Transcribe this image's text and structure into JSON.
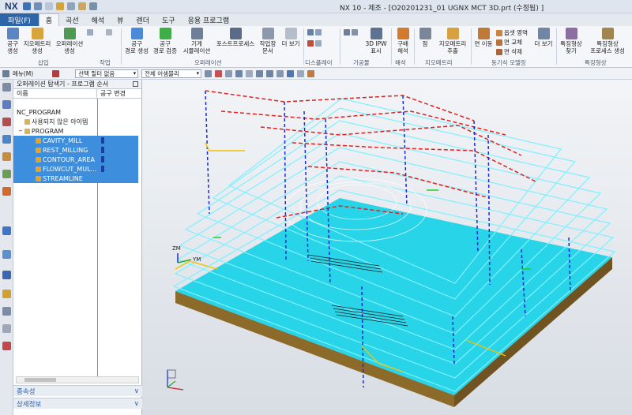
{
  "app": {
    "logo": "NX",
    "window_title": "NX 10 - 제조 - [O20201231_01 UGNX MCT 3D.prt (수정됨) ]"
  },
  "menu_tabs": {
    "file": "파일(F)",
    "tabs": [
      "홈",
      "곡선",
      "해석",
      "뷰",
      "렌더",
      "도구",
      "응용 프로그램"
    ]
  },
  "ribbon": {
    "buttons": [
      {
        "label": "공구\n생성",
        "icon": "create-tool-icon"
      },
      {
        "label": "지오메트리\n생성",
        "icon": "create-geometry-icon"
      },
      {
        "label": "오퍼레이션\n생성",
        "icon": "create-operation-icon"
      },
      {
        "label": "공구\n경로 생성",
        "icon": "generate-toolpath-icon"
      },
      {
        "label": "공구\n경로 검증",
        "icon": "verify-toolpath-icon"
      },
      {
        "label": "기계\n시뮬레이션",
        "icon": "machine-simulation-icon"
      },
      {
        "label": "포스트프로세스",
        "icon": "postprocess-icon"
      },
      {
        "label": "작업장\n문서",
        "icon": "shop-docs-icon"
      },
      {
        "label": "더 보기",
        "icon": "more-icon"
      },
      {
        "label": "3D IPW\n표시",
        "icon": "ipw-icon"
      },
      {
        "label": "구배\n해석",
        "icon": "draft-analysis-icon"
      },
      {
        "label": "점",
        "icon": "point-icon"
      },
      {
        "label": "지오메트리\n추출",
        "icon": "extract-geometry-icon"
      },
      {
        "label": "면 이동",
        "icon": "move-face-icon"
      },
      {
        "label": "더 보기",
        "icon": "more-icon-2"
      },
      {
        "label": "특징형상\n찾기",
        "icon": "find-feature-icon"
      },
      {
        "label": "특징형상\n프로세스 생성",
        "icon": "feature-process-icon"
      }
    ],
    "small_items": [
      "옵셋 영역",
      "면 교체",
      "면 삭제"
    ],
    "groups": [
      "삽입",
      "작업",
      "오퍼레이션",
      "디스플레이",
      "가공물",
      "해석",
      "지오메트리",
      "동기식 모델링",
      "특징형상"
    ]
  },
  "toolbar2": {
    "menu_label": "메뉴(M)",
    "selection_filter": "선택 필터 없음",
    "assembly_scope": "전체 어셈블리"
  },
  "navigator": {
    "title": "오퍼레이션 탐색기 - 프로그램 순서",
    "col_name": "이름",
    "col_tool": "공구 변경",
    "rows": [
      {
        "label": "NC_PROGRAM",
        "indent": 0,
        "selected": false
      },
      {
        "label": "사용되지 않은 아이템",
        "indent": 1,
        "selected": false
      },
      {
        "label": "PROGRAM",
        "indent": 1,
        "selected": false
      },
      {
        "label": "CAVITY_MILL",
        "indent": 2,
        "selected": true
      },
      {
        "label": "REST_MILLING",
        "indent": 2,
        "selected": true
      },
      {
        "label": "CONTOUR_AREA",
        "indent": 2,
        "selected": true
      },
      {
        "label": "FLOWCUT_MUL...",
        "indent": 2,
        "selected": true
      },
      {
        "label": "STREAMLINE",
        "indent": 2,
        "selected": true
      }
    ],
    "panel_dependencies": "종속성",
    "panel_details": "상세정보"
  },
  "viewport": {
    "axis_zm": "ZM",
    "axis_ym": "YM",
    "colors": {
      "part_top": "#28d4e8",
      "part_side": "#8b6a2a",
      "toolpath_cyan": "#27d8f0",
      "rapid_red": "#e02020",
      "plunge_blue": "#1a2bd6",
      "approach_yellow": "#f2c200",
      "engage_green": "#28c828"
    }
  }
}
